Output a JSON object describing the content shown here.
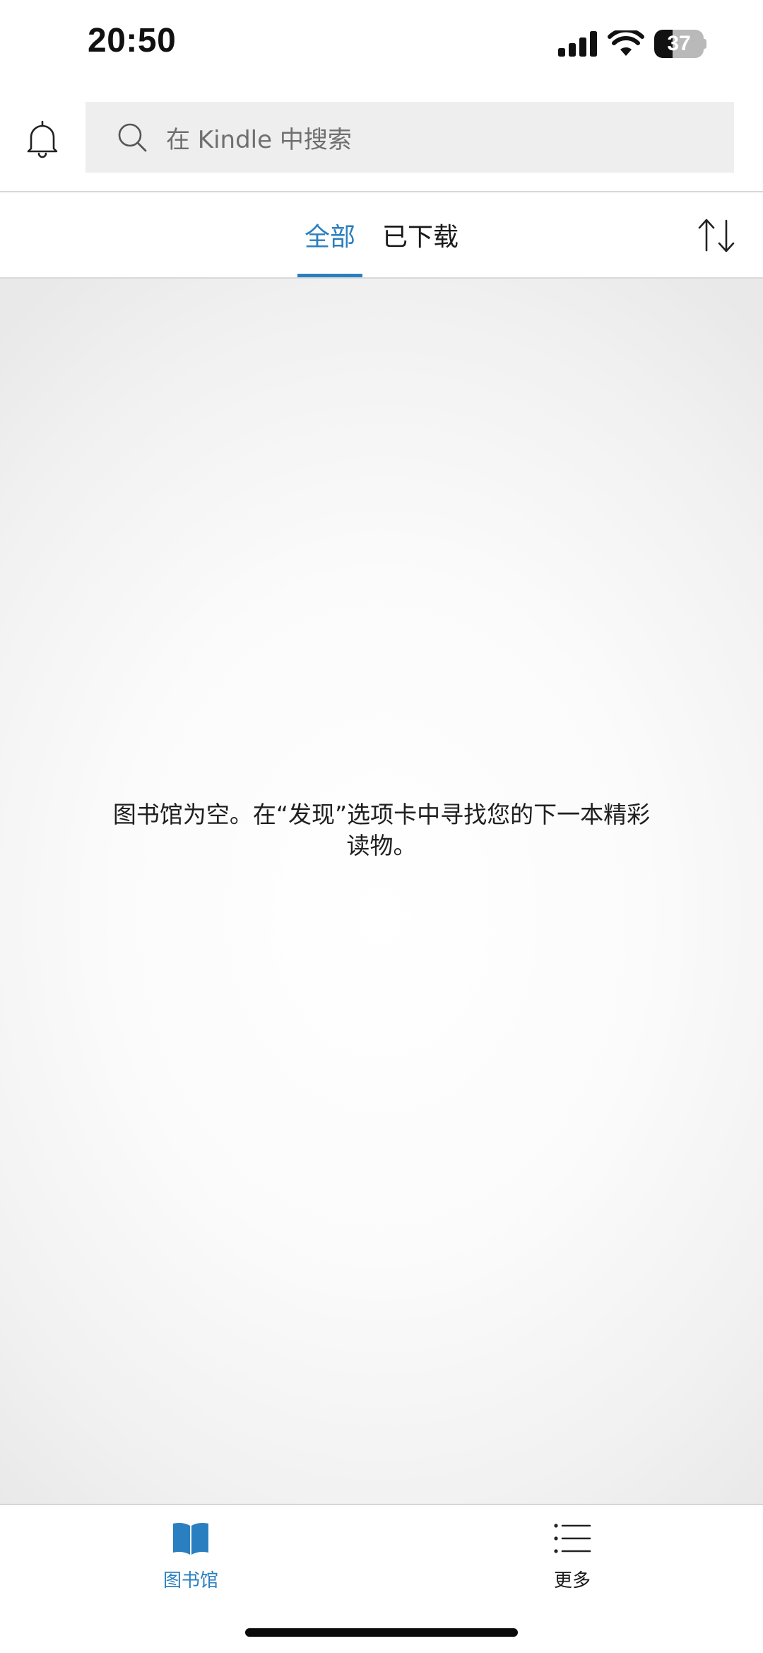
{
  "status_bar": {
    "time": "20:50",
    "battery_level": "37",
    "battery_fraction": 0.37
  },
  "header": {
    "search_placeholder": "在 Kindle 中搜索"
  },
  "tabs": [
    {
      "label": "全部",
      "selected": true
    },
    {
      "label": "已下载",
      "selected": false
    }
  ],
  "main": {
    "empty_message": "图书馆为空。在“发现”选项卡中寻找您的下一本精彩读物。"
  },
  "bottom_nav": [
    {
      "label": "图书馆",
      "icon": "book-icon",
      "selected": true
    },
    {
      "label": "更多",
      "icon": "menu-list-icon",
      "selected": false
    }
  ],
  "colors": {
    "accent": "#2a7fc0",
    "search_bg": "#eeeeee",
    "text_primary": "#1a1a1a"
  }
}
